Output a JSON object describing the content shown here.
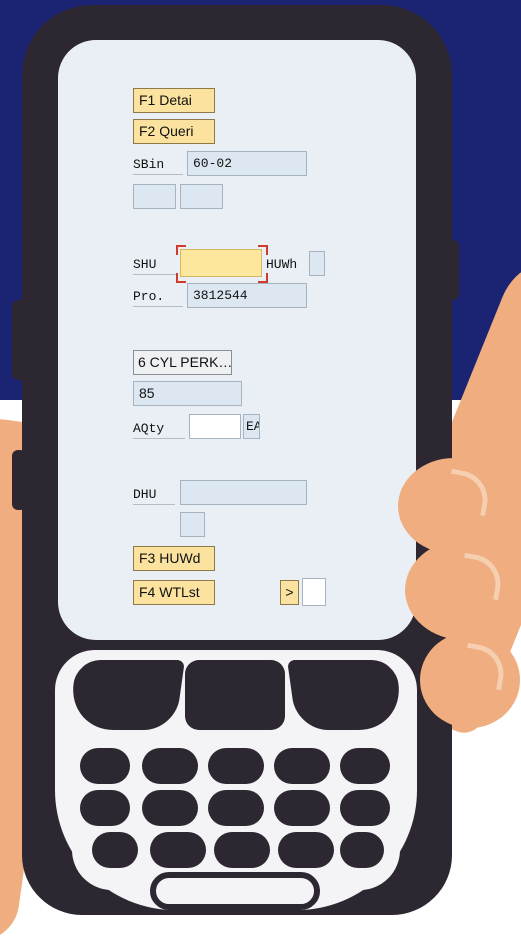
{
  "buttons": {
    "f1": "F1 Detai",
    "f2": "F2 Queri",
    "f3": "F3 HUWd",
    "f4": "F4 WTLst",
    "next": ">"
  },
  "labels": {
    "sbin": "SBin",
    "shu": "SHU",
    "huwh": "HUWh",
    "pro": "Pro.",
    "aqty": "AQty",
    "unit": "EA",
    "dhu": "DHU"
  },
  "fields": {
    "sbin_value": "60-02",
    "pro_value": "3812544",
    "description": "6 CYL PERK…",
    "quantity": "85",
    "shu_value": "",
    "aqty_value": "",
    "dhu_value": ""
  },
  "colors": {
    "background_top": "#1a2473",
    "device": "#2c2730",
    "screen": "#e9eff5",
    "button": "#fbe39f",
    "field": "#dde7f1",
    "skin": "#efad80"
  }
}
